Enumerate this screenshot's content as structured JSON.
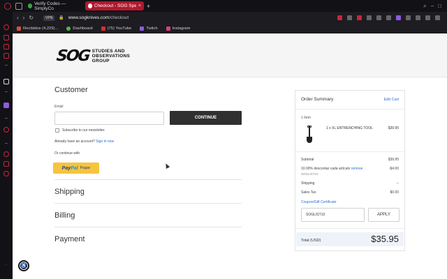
{
  "browser": {
    "tabs": [
      {
        "label": "Verify Codes — SimplyCo",
        "active": false
      },
      {
        "label": "Checkout - SOG Speciali",
        "active": true
      }
    ],
    "new_tab": "+",
    "vpn_badge": "VPN",
    "url_domain": "www.sogknives.com",
    "url_path": "/checkout",
    "bookmarks": [
      {
        "label": "Recibidos (4,229)...",
        "icon_color": "#e14b3b"
      },
      {
        "label": "Dashboard",
        "icon_color": "#58b34a"
      },
      {
        "label": "(75) YouTube",
        "icon_color": "#e02a2a"
      },
      {
        "label": "Twitch",
        "icon_color": "#8e5be0"
      },
      {
        "label": "Instagram",
        "icon_color": "#d6407b"
      }
    ]
  },
  "brand": {
    "logo_mark": "SOG",
    "logo_line1": "STUDIES AND",
    "logo_line2": "OBSERVATIONS",
    "logo_line3": "GROUP"
  },
  "customer": {
    "title": "Customer",
    "email_label": "Email",
    "email_value": "",
    "continue_label": "CONTINUE",
    "newsletter_label": "Subscribe to our newsletter.",
    "already_text": "Already have an account?",
    "signin_link": "Sign in now",
    "or_continue": "Or continue with",
    "paypal_label_a": "Pay",
    "paypal_label_b": "Pal",
    "paypal_pagar": "Pagar"
  },
  "sections": {
    "shipping": "Shipping",
    "billing": "Billing",
    "payment": "Payment"
  },
  "summary": {
    "title": "Order Summary",
    "edit_cart": "Edit Cart",
    "items_count": "1 Item",
    "item_name": "1 x XL ENTRENCHING TOOL",
    "item_price": "$39.95",
    "subtotal_label": "Subtotal",
    "subtotal_value": "$39.95",
    "discount_label": "10.00% descontar cada artículo",
    "discount_remove": "remove",
    "discount_code": "SOGLIST10",
    "discount_value": "-$4.00",
    "shipping_label": "Shipping",
    "shipping_value": "--",
    "tax_label": "Sales Tax",
    "tax_value": "$0.00",
    "coupon_link": "Coupon/Gift Certificate",
    "coupon_value": "SOGLIST10",
    "apply_label": "APPLY",
    "total_label": "Total (USD)",
    "total_value": "$35.95"
  },
  "colors": {
    "accent_red": "#b0192f",
    "link_blue": "#2a6bd0",
    "paypal_yellow": "#f6c43d",
    "button_dark": "#303030"
  }
}
